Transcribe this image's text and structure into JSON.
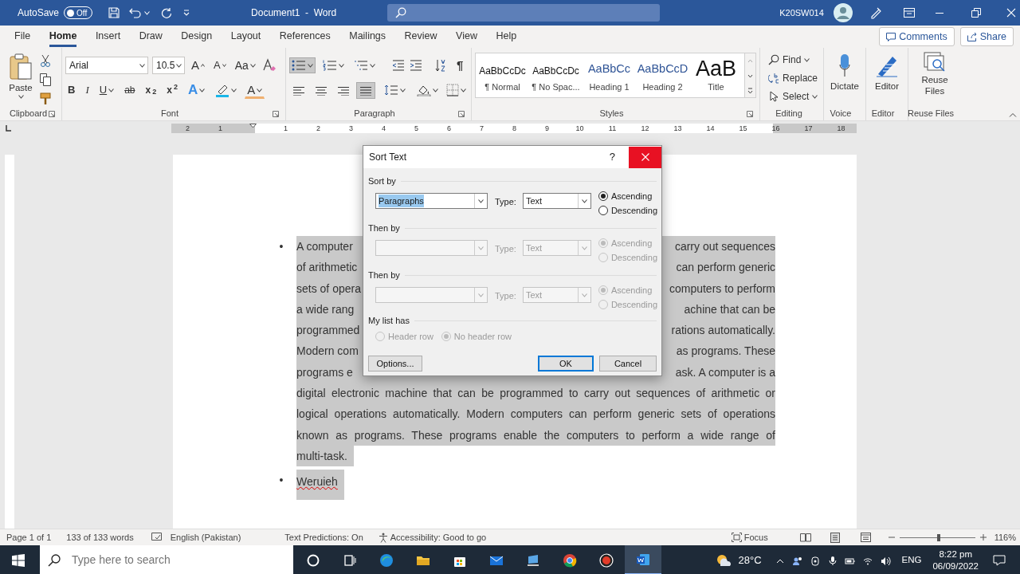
{
  "title_bar": {
    "autosave_label": "AutoSave",
    "autosave": {
      "label": "Off",
      "on": false
    },
    "document_title": "Document1  -  Word",
    "user": "K20SW014"
  },
  "menu_tabs": [
    {
      "label": "File",
      "selected": false
    },
    {
      "label": "Home",
      "selected": true
    },
    {
      "label": "Insert",
      "selected": false
    },
    {
      "label": "Draw",
      "selected": false
    },
    {
      "label": "Design",
      "selected": false
    },
    {
      "label": "Layout",
      "selected": false
    },
    {
      "label": "References",
      "selected": false
    },
    {
      "label": "Mailings",
      "selected": false
    },
    {
      "label": "Review",
      "selected": false
    },
    {
      "label": "View",
      "selected": false
    },
    {
      "label": "Help",
      "selected": false
    }
  ],
  "comments_button": "Comments",
  "share_button": "Share",
  "ribbon": {
    "clipboard": {
      "paste": "Paste",
      "label": "Clipboard"
    },
    "font": {
      "font_name": "Arial",
      "font_size": "10.5",
      "grow": "A",
      "shrink": "A",
      "change_case": "Aa",
      "bold": "B",
      "italic": "I",
      "underline": "U",
      "strikethrough": "ab",
      "subscript": "x$_{2}$",
      "superscript": "x$^{2}$",
      "text_effects": "A",
      "font_color": "A",
      "label": "Font"
    },
    "paragraph": {
      "label": "Paragraph",
      "bullets_selected": true,
      "show_marks": "¶",
      "alignments": [
        {
          "selected": false
        },
        {
          "selected": false
        },
        {
          "selected": false
        },
        {
          "selected": true
        }
      ]
    },
    "styles": {
      "label": "Styles",
      "items": [
        {
          "preview": "AaBbCcDc",
          "name": "¶ Normal",
          "kind": "body"
        },
        {
          "preview": "AaBbCcDc",
          "name": "¶ No Spac...",
          "kind": "body"
        },
        {
          "preview": "AaBbCc",
          "name": "Heading 1",
          "kind": "heading"
        },
        {
          "preview": "AaBbCcD",
          "name": "Heading 2",
          "kind": "heading"
        },
        {
          "preview": "AaB",
          "name": "Title",
          "kind": "title"
        }
      ]
    },
    "editing": {
      "label": "Editing",
      "find": "Find",
      "replace": "Replace",
      "select": "Select"
    },
    "voice": {
      "label": "Voice",
      "button": "Dictate"
    },
    "editor": {
      "label": "Editor",
      "button": "Editor"
    },
    "reuse_files": {
      "label": "Reuse Files",
      "button": "Reuse Files"
    }
  },
  "ruler": {
    "left_numbers": [
      "2",
      "1"
    ],
    "right_numbers": [
      "1",
      "2",
      "3",
      "4",
      "5",
      "6",
      "7",
      "8",
      "9",
      "10",
      "11",
      "12",
      "13",
      "14",
      "15",
      "16",
      "17",
      "18"
    ]
  },
  "document": {
    "items": [
      {
        "bullet": "•",
        "selected": true,
        "spelling_error": false,
        "lines": [
          {
            "left": "A computer",
            "right": "carry out sequences"
          },
          {
            "left": "of arithmetic",
            "right": "can perform generic"
          },
          {
            "left": "sets of opera",
            "right": "computers to perform"
          },
          {
            "left": "a wide rang",
            "right": "achine that can be"
          },
          {
            "left": "programmed",
            "right": "rations automatically."
          },
          {
            "left": "Modern com",
            "right": "as programs. These"
          },
          {
            "left": "programs e",
            "right": "ask. A computer is a"
          },
          {
            "text": "digital electronic machine that can be programmed to carry out sequences of arithmetic or",
            "justified": true
          },
          {
            "text": "logical operations automatically. Modern computers can perform generic sets of operations",
            "justified": true
          },
          {
            "text": "known as programs. These programs enable the computers to perform a wide range of",
            "justified": true
          },
          {
            "text": "multi-task.",
            "justified": false
          }
        ]
      },
      {
        "bullet": "•",
        "selected": true,
        "spelling_error": true,
        "lines": [
          {
            "text": "Weruieh",
            "justified": false
          }
        ]
      }
    ]
  },
  "dialog": {
    "title": "Sort Text",
    "help": "?",
    "sections": [
      {
        "label": "Sort by",
        "disabled": false,
        "value": "Paragraphs",
        "value_selected": true,
        "type_label": "Type:",
        "type_value": "Text",
        "options": [
          {
            "label": "Ascending",
            "selected": true
          },
          {
            "label": "Descending",
            "selected": false
          }
        ]
      },
      {
        "label": "Then by",
        "disabled": true,
        "type_label": "Type:",
        "type_value": "Text",
        "options": [
          {
            "label": "Ascending",
            "selected": true
          },
          {
            "label": "Descending",
            "selected": false
          }
        ]
      },
      {
        "label": "Then by",
        "disabled": true,
        "type_label": "Type:",
        "type_value": "Text",
        "options": [
          {
            "label": "Ascending",
            "selected": true
          },
          {
            "label": "Descending",
            "selected": false
          }
        ]
      }
    ],
    "list_label": "My list has",
    "list_disabled": true,
    "list_options": [
      {
        "label": "Header row",
        "selected": false
      },
      {
        "label": "No header row",
        "selected": true
      }
    ],
    "buttons": [
      {
        "label": "Options...",
        "default": false
      },
      {
        "label": "OK",
        "default": true
      },
      {
        "label": "Cancel",
        "default": false
      }
    ]
  },
  "status_bar": {
    "page": "Page 1 of 1",
    "words": "133 of 133 words",
    "language": "English (Pakistan)",
    "predictions": "Text Predictions: On",
    "accessibility": "Accessibility: Good to go",
    "focus": "Focus",
    "zoom": {
      "level": 0.52
    },
    "zoom_text": "116%"
  },
  "taskbar": {
    "search_placeholder": "Type here to search",
    "temperature": "28°C",
    "language": "ENG",
    "time": "8:22 pm",
    "date": "06/09/2022"
  }
}
